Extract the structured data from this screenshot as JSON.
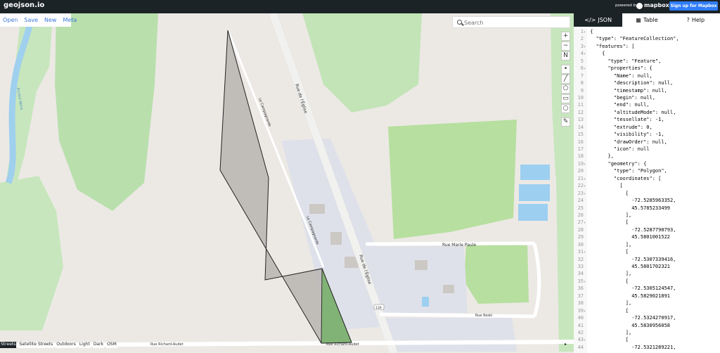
{
  "app": {
    "logo": "geojson.io",
    "powered_by": "powered by",
    "mapbox": "mapbox",
    "signup": "Sign up for Mapbox"
  },
  "file_menu": [
    "Open",
    "Save",
    "New",
    "Meta"
  ],
  "search": {
    "placeholder": "Search"
  },
  "tools": [
    "+",
    "−",
    "N",
    "•",
    "╱",
    "⬠",
    "▭",
    "○",
    "✎"
  ],
  "map_labels": [
    "Rue de l'Église",
    "Le Campagnarde",
    "Le Campagnarde",
    "Rue Marie Paule",
    "Rue de l'Église",
    "Rue Roski",
    "Rue Richard-Audet",
    "Rue Richard-Audet",
    "Rivière Noire",
    "139"
  ],
  "layers": [
    "Streets",
    "Satellite Streets",
    "Outdoors",
    "Light",
    "Dark",
    "OSM"
  ],
  "tabs": [
    "JSON",
    "Table",
    "Help"
  ],
  "code_lines": [
    "{",
    "  \"type\": \"FeatureCollection\",",
    "  \"features\": [",
    "    {",
    "      \"type\": \"Feature\",",
    "      \"properties\": {",
    "        \"Name\": null,",
    "        \"description\": null,",
    "        \"timestamp\": null,",
    "        \"begin\": null,",
    "        \"end\": null,",
    "        \"altitudeMode\": null,",
    "        \"tessellate\": -1,",
    "        \"extrude\": 0,",
    "        \"visibility\": -1,",
    "        \"drawOrder\": null,",
    "        \"icon\": null",
    "      },",
    "      \"geometry\": {",
    "        \"type\": \"Polygon\",",
    "        \"coordinates\": [",
    "          [",
    "            [",
    "              -72.5285963352,",
    "              45.5785233499",
    "            ],",
    "            [",
    "              -72.5287790793,",
    "              45.5801001522",
    "            ],",
    "            [",
    "              -72.5307339416,",
    "              45.5801702321",
    "            ],",
    "            [",
    "              -72.5305124547,",
    "              45.5829021891",
    "            ],",
    "            [",
    "              -72.5324270917,",
    "              45.5830956058",
    "            ],",
    "            [",
    "              -72.5321289221,"
  ],
  "folded_lines": [
    1,
    3,
    4,
    6,
    19,
    21,
    22,
    23,
    27,
    31,
    35,
    39,
    43
  ]
}
